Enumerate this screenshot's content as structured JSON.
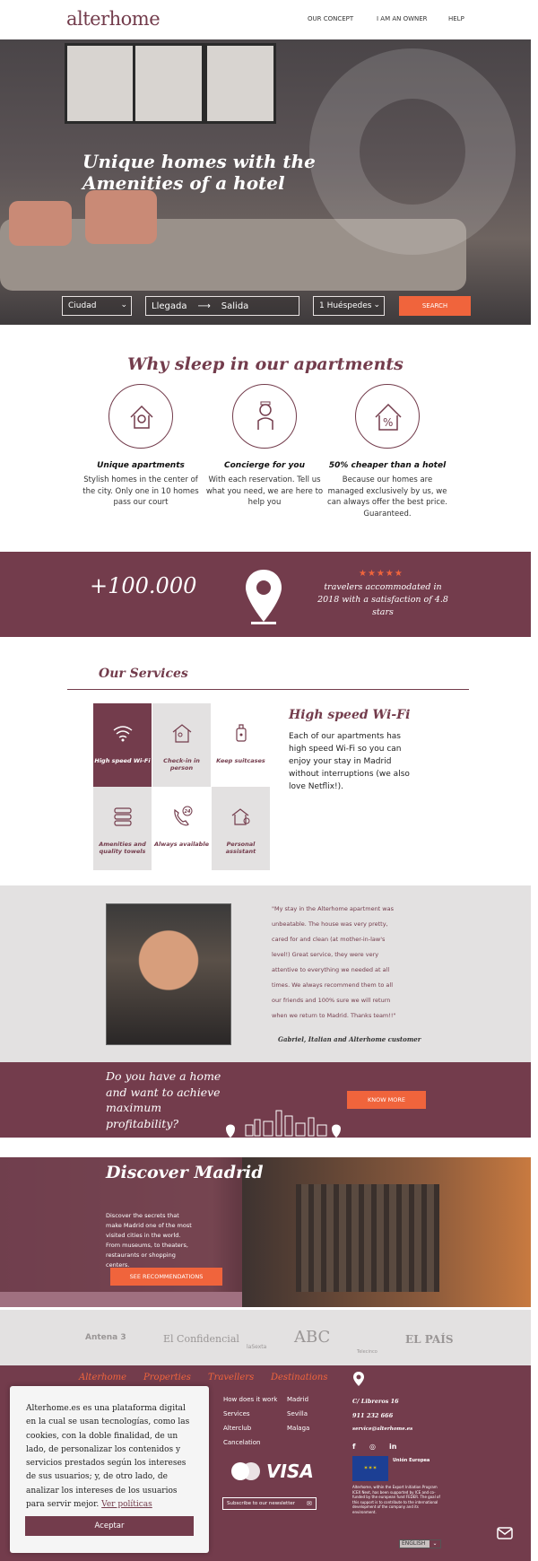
{
  "header": {
    "logo": "alterhome",
    "nav": [
      "OUR CONCEPT",
      "I AM AN OWNER",
      "HELP"
    ]
  },
  "hero": {
    "title": "Unique homes with the Amenities of a hotel",
    "city_placeholder": "Ciudad",
    "checkin": "Llegada",
    "checkout": "Salida",
    "guests": "1 Huéspedes",
    "search": "SEARCH"
  },
  "why": {
    "title": "Why sleep in our apartments",
    "features": [
      {
        "title": "Unique apartments",
        "text": "Stylish homes in the center of the city. Only one in 10 homes pass our court",
        "icon": "house-pin-icon"
      },
      {
        "title": "Concierge for you",
        "text": "With each reservation. Tell us what you need, we are here to help you",
        "icon": "concierge-icon"
      },
      {
        "title": "50% cheaper than a hotel",
        "text": "Because our homes are managed exclusively by us, we can always offer the best price. Guaranteed.",
        "icon": "percent-house-icon"
      }
    ]
  },
  "stats": {
    "number": "+100.000",
    "stars": "★★★★★",
    "text": "travelers accommodated in 2018 with a satisfaction of 4.8 stars",
    "rating": 4.8
  },
  "services": {
    "title": "Our Services",
    "tiles": [
      {
        "label": "High speed Wi-Fi",
        "icon": "wifi-icon",
        "active": true
      },
      {
        "label": "Check-in in person",
        "icon": "checkin-icon",
        "active": false
      },
      {
        "label": "Keep suitcases",
        "icon": "suitcase-icon",
        "active": false
      },
      {
        "label": "Amenities and quality towels",
        "icon": "towels-icon",
        "active": false
      },
      {
        "label": "Always available",
        "icon": "phone-24h-icon",
        "active": false
      },
      {
        "label": "Personal assistant",
        "icon": "assistant-icon",
        "active": false
      }
    ],
    "detail_title": "High speed Wi-Fi",
    "detail_text": "Each of our apartments has high speed Wi-Fi so you can enjoy your stay in Madrid without interruptions (we also love Netflix!)."
  },
  "testimonial": {
    "quote": "\"My stay in the Alterhome apartment was unbeatable. The house was very pretty, cared for and clean (at mother-in-law's level!) Great service, they were very attentive to everything we needed at all times. We always recommend them to all our friends and 100% sure we will return when we return to Madrid. Thanks team!!\"",
    "author": "Gabriel, Italian and Alterhome customer"
  },
  "owner": {
    "title": "Do you have a home and want to achieve maximum profitability?",
    "button": "KNOW MORE"
  },
  "discover": {
    "title": "Discover Madrid",
    "text": "Discover the secrets that make Madrid one of the most visited cities in the world. From museums, to theaters, restaurants or shopping centers.",
    "button": "SEE RECOMMENDATIONS"
  },
  "press": [
    "Antena 3",
    "El Confidencial",
    "laSexta",
    "ABC",
    "Telecinco",
    "EL PAÍS"
  ],
  "footer": {
    "headings": [
      "Alterhome",
      "Properties",
      "Travellers",
      "Destinations"
    ],
    "travellers": [
      "How does it work",
      "Services",
      "Alterclub",
      "Cancelation"
    ],
    "destinations": [
      "Madrid",
      "Sevilla",
      "Malaga"
    ],
    "address": "C/ Libreros 16",
    "phone": "911 232 666",
    "email": "service@alterhome.es",
    "newsletter": "Subscribe to our newsletter",
    "eu_title": "Unión Europea",
    "eu_text": "Alterhome, within the Export Initiation Program ICEX Next, has been supported by ICE and co-funded by the european fund FEDER. The goal of this support is to contribute to the international development of the company and its environment.",
    "language": "ENGLISH"
  },
  "cookie": {
    "text": "Alterhome.es es una plataforma digital en la cual se usan tecnologías, como las cookies, con la doble finalidad, de un lado, de personalizar los contenidos y servicios prestados según los intereses de sus usuarios; y, de otro lado, de analizar los intereses de los usuarios para servir mejor.",
    "link": "Ver políticas",
    "accept": "Aceptar"
  }
}
